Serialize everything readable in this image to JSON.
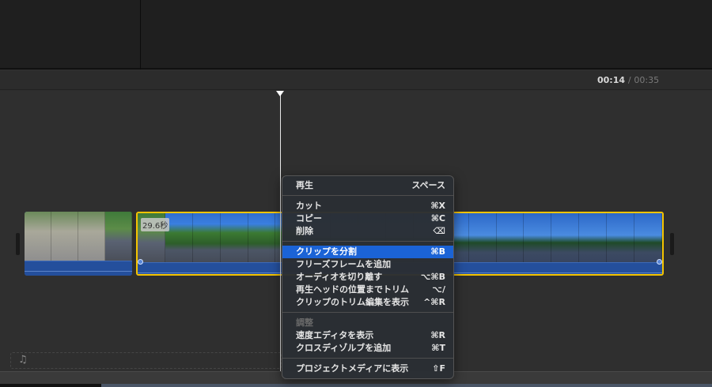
{
  "timecode": {
    "current": "00:14",
    "separator": "/",
    "total": "00:35"
  },
  "clip2": {
    "duration_label": "29.6秒"
  },
  "audio_well": {
    "icon": "music-note-icon",
    "glyph": "♫"
  },
  "context_menu": {
    "sections": [
      [
        {
          "label": "再生",
          "shortcut": "スペース"
        }
      ],
      [
        {
          "label": "カット",
          "shortcut": "⌘X"
        },
        {
          "label": "コピー",
          "shortcut": "⌘C"
        },
        {
          "label": "削除",
          "shortcut": "⌫"
        }
      ],
      [
        {
          "label": "クリップを分割",
          "shortcut": "⌘B",
          "selected": true
        },
        {
          "label": "フリーズフレームを追加",
          "shortcut": ""
        },
        {
          "label": "オーディオを切り離す",
          "shortcut": "⌥⌘B"
        },
        {
          "label": "再生ヘッドの位置までトリム",
          "shortcut": "⌥/"
        },
        {
          "label": "クリップのトリム編集を表示",
          "shortcut": "^⌘R"
        }
      ],
      [
        {
          "label": "調整",
          "shortcut": "",
          "disabled": true
        },
        {
          "label": "速度エディタを表示",
          "shortcut": "⌘R"
        },
        {
          "label": "クロスディゾルブを追加",
          "shortcut": "⌘T"
        }
      ],
      [
        {
          "label": "プロジェクトメディアに表示",
          "shortcut": "⇧F"
        }
      ]
    ]
  },
  "colors": {
    "selection": "#1b63d6",
    "clip_border": "#f5c400",
    "audio": "#244f9c"
  }
}
